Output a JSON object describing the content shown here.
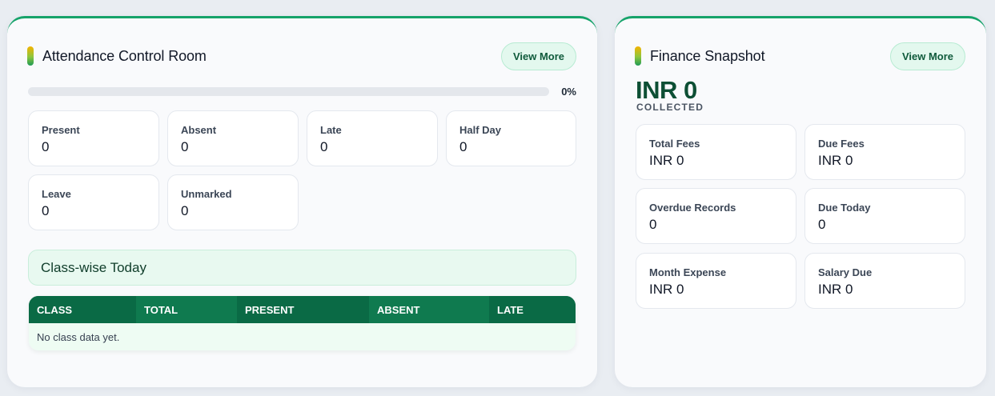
{
  "attendance": {
    "title": "Attendance Control Room",
    "view_more": "View More",
    "progress": {
      "percent": 0,
      "label": "0%"
    },
    "stats": [
      {
        "label": "Present",
        "value": "0"
      },
      {
        "label": "Absent",
        "value": "0"
      },
      {
        "label": "Late",
        "value": "0"
      },
      {
        "label": "Half Day",
        "value": "0"
      },
      {
        "label": "Leave",
        "value": "0"
      },
      {
        "label": "Unmarked",
        "value": "0"
      }
    ],
    "classwise": {
      "title": "Class-wise Today",
      "columns": [
        "CLASS",
        "TOTAL",
        "PRESENT",
        "ABSENT",
        "LATE"
      ],
      "empty_text": "No class data yet."
    }
  },
  "finance": {
    "title": "Finance Snapshot",
    "view_more": "View More",
    "collected_amount": "INR 0",
    "collected_label": "COLLECTED",
    "stats": [
      {
        "label": "Total Fees",
        "value": "INR 0"
      },
      {
        "label": "Due Fees",
        "value": "INR 0"
      },
      {
        "label": "Overdue Records",
        "value": "0"
      },
      {
        "label": "Due Today",
        "value": "0"
      },
      {
        "label": "Month Expense",
        "value": "INR 0"
      },
      {
        "label": "Salary Due",
        "value": "INR 0"
      }
    ]
  },
  "colors": {
    "accent": "#16a36a",
    "header_green": "#0a6a45",
    "amount_green": "#0d4f34"
  }
}
